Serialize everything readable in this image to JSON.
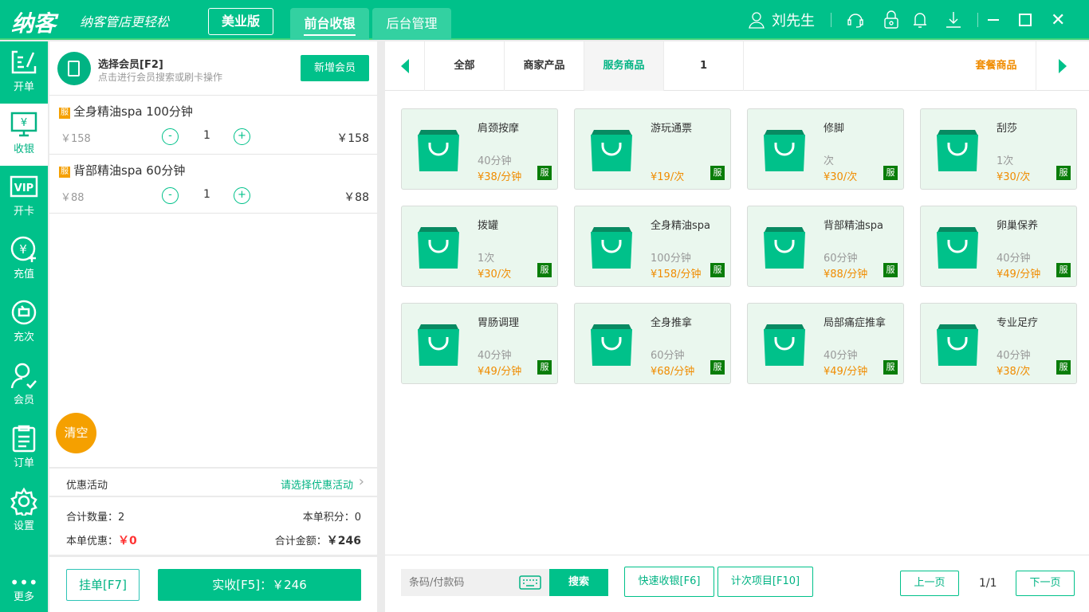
{
  "header": {
    "logo": "纳客",
    "slogan": "纳客管店更轻松",
    "edition": "美业版",
    "tabs": [
      {
        "label": "前台收银"
      },
      {
        "label": "后台管理"
      }
    ],
    "user": "刘先生"
  },
  "sidebar": {
    "items": [
      {
        "label": "开单"
      },
      {
        "label": "收银"
      },
      {
        "label": "开卡"
      },
      {
        "label": "充值"
      },
      {
        "label": "充次"
      },
      {
        "label": "会员"
      },
      {
        "label": "订单"
      },
      {
        "label": "设置"
      },
      {
        "label": "更多"
      }
    ]
  },
  "member": {
    "title": "选择会员[F2]",
    "subtitle": "点击进行会员搜索或刷卡操作",
    "add_label": "新增会员"
  },
  "cart": [
    {
      "badge": "服",
      "name": "全身精油spa 100分钟",
      "price": "￥158",
      "qty": "1",
      "total": "￥158"
    },
    {
      "badge": "服",
      "name": "背部精油spa 60分钟",
      "price": "￥88",
      "qty": "1",
      "total": "￥88"
    }
  ],
  "cart_controls": {
    "minus": "-",
    "plus": "+"
  },
  "clear_label": "清空",
  "promo": {
    "label": "优惠活动",
    "placeholder": "请选择优惠活动"
  },
  "summary": {
    "count_label": "合计数量：",
    "count": "2",
    "points_label": "本单积分：",
    "points": "0",
    "discount_label": "本单优惠：",
    "discount": "￥0",
    "amount_label": "合计金额：",
    "amount": "￥246"
  },
  "actions": {
    "hold": "挂单[F7]",
    "pay": "实收[F5]：￥246"
  },
  "categories": [
    {
      "label": "全部"
    },
    {
      "label": "商家产品"
    },
    {
      "label": "服务商品"
    },
    {
      "label": "1"
    },
    {
      "label": "套餐商品"
    }
  ],
  "products": [
    {
      "name": "肩颈按摩",
      "unit": "40分钟",
      "price": "¥38/分钟",
      "badge": "服"
    },
    {
      "name": "游玩通票",
      "unit": "",
      "price": "¥19/次",
      "badge": "服"
    },
    {
      "name": "修脚",
      "unit": "次",
      "price": "¥30/次",
      "badge": "服"
    },
    {
      "name": "刮莎",
      "unit": "1次",
      "price": "¥30/次",
      "badge": "服"
    },
    {
      "name": "拨罐",
      "unit": "1次",
      "price": "¥30/次",
      "badge": "服"
    },
    {
      "name": "全身精油spa",
      "unit": "100分钟",
      "price": "¥158/分钟",
      "badge": "服"
    },
    {
      "name": "背部精油spa",
      "unit": "60分钟",
      "price": "¥88/分钟",
      "badge": "服"
    },
    {
      "name": "卵巢保养",
      "unit": "40分钟",
      "price": "¥49/分钟",
      "badge": "服"
    },
    {
      "name": "胃肠调理",
      "unit": "40分钟",
      "price": "¥49/分钟",
      "badge": "服"
    },
    {
      "name": "全身推拿",
      "unit": "60分钟",
      "price": "¥68/分钟",
      "badge": "服"
    },
    {
      "name": "局部痛症推拿",
      "unit": "40分钟",
      "price": "¥49/分钟",
      "badge": "服"
    },
    {
      "name": "专业足疗",
      "unit": "40分钟",
      "price": "¥38/次",
      "badge": "服"
    }
  ],
  "bottom": {
    "search_placeholder": "条码/付款码",
    "search_label": "搜索",
    "quick": "快速收银[F6]",
    "count_items": "计次项目[F10]",
    "prev": "上一页",
    "page": "1/1",
    "next": "下一页"
  }
}
